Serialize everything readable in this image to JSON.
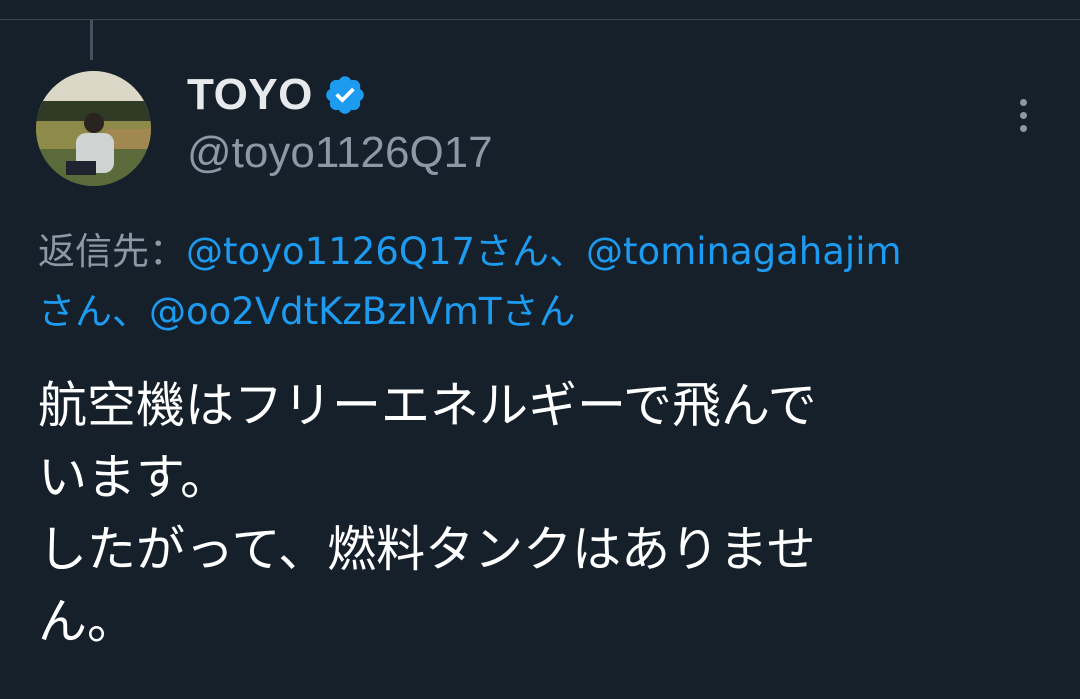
{
  "colors": {
    "background": "#15202b",
    "link": "#1d9bf0",
    "secondary_text": "#8b98a5",
    "primary_text": "#ffffff",
    "verified": "#1d9bf0"
  },
  "author": {
    "display_name": "TOYO",
    "handle": "@toyo1126Q17",
    "verified_icon": "verified-badge-icon",
    "avatar_icon": "profile-photo"
  },
  "reply_to": {
    "label": "返信先：",
    "mentions": [
      "@toyo1126Q17さん、",
      "@tominagahajim",
      "さん、",
      "@oo2VdtKzBzIVmTさん"
    ]
  },
  "tweet": {
    "lines": [
      "航空機はフリーエネルギーで飛んで",
      "います。",
      "したがって、燃料タンクはありませ",
      "ん。"
    ]
  },
  "more_icon": "more-vertical-icon"
}
